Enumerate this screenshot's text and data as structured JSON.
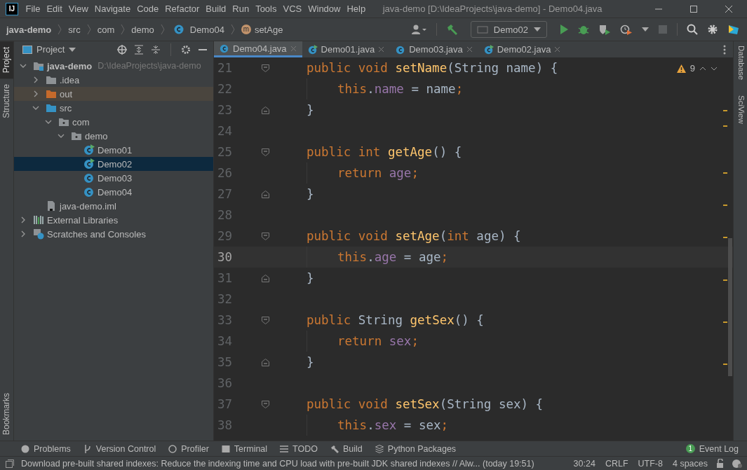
{
  "window": {
    "logo": "IJ",
    "title": "java-demo [D:\\IdeaProjects\\java-demo] - Demo04.java"
  },
  "menu": [
    "File",
    "Edit",
    "View",
    "Navigate",
    "Code",
    "Refactor",
    "Build",
    "Run",
    "Tools",
    "VCS",
    "Window",
    "Help"
  ],
  "breadcrumbs": [
    {
      "text": "java-demo",
      "kind": "path"
    },
    {
      "text": "src",
      "kind": "path"
    },
    {
      "text": "com",
      "kind": "path"
    },
    {
      "text": "demo",
      "kind": "path"
    },
    {
      "text": "Demo04",
      "kind": "class"
    },
    {
      "text": "setAge",
      "kind": "method",
      "icon_text": "m"
    }
  ],
  "run_config": "Demo02",
  "left_stripe": [
    {
      "label": "Project",
      "selected": true
    },
    {
      "label": "Structure",
      "selected": false
    }
  ],
  "left_stripe_bottom": "Bookmarks",
  "right_stripe": [
    "Database",
    "SciView"
  ],
  "project_panel": {
    "title": "Project",
    "tree": [
      {
        "label": "java-demo",
        "note": "D:\\IdeaProjects\\java-demo",
        "kind": "module",
        "expanded": true,
        "selected": false,
        "children": [
          {
            "label": ".idea",
            "kind": "folder",
            "expanded": false,
            "selected": false
          },
          {
            "label": "out",
            "kind": "excluded",
            "expanded": false,
            "selected": false
          },
          {
            "label": "src",
            "kind": "sources",
            "expanded": true,
            "selected": false,
            "children": [
              {
                "label": "com",
                "kind": "package",
                "expanded": true,
                "selected": false,
                "children": [
                  {
                    "label": "demo",
                    "kind": "package",
                    "expanded": true,
                    "selected": false,
                    "children": [
                      {
                        "label": "Demo01",
                        "kind": "runnable",
                        "selected": false
                      },
                      {
                        "label": "Demo02",
                        "kind": "runnable",
                        "selected": true
                      },
                      {
                        "label": "Demo03",
                        "kind": "class",
                        "selected": false
                      },
                      {
                        "label": "Demo04",
                        "kind": "class",
                        "selected": false
                      }
                    ]
                  }
                ]
              }
            ]
          },
          {
            "label": "java-demo.iml",
            "kind": "file",
            "selected": false
          }
        ]
      },
      {
        "label": "External Libraries",
        "kind": "libraries",
        "expanded": false,
        "selected": false
      },
      {
        "label": "Scratches and Consoles",
        "kind": "scratches",
        "expanded": false,
        "selected": false
      }
    ]
  },
  "tabs": [
    {
      "label": "Demo04.java",
      "kind": "class",
      "selected": true
    },
    {
      "label": "Demo01.java",
      "kind": "runnable",
      "selected": false
    },
    {
      "label": "Demo03.java",
      "kind": "class",
      "selected": false
    },
    {
      "label": "Demo02.java",
      "kind": "runnable",
      "selected": false
    }
  ],
  "inspection": {
    "warnings": "9"
  },
  "editor": {
    "lines": [
      {
        "number": "21",
        "kind": "open",
        "current": false,
        "tokens": [
          {
            "kind": "keyword",
            "text": "public void "
          },
          {
            "kind": "method",
            "text": "setName"
          },
          {
            "kind": "plain",
            "text": "(String name) {"
          }
        ]
      },
      {
        "number": "22",
        "kind": "body",
        "current": false,
        "tokens": [
          {
            "kind": "keyword",
            "text": "this"
          },
          {
            "kind": "plain",
            "text": "."
          },
          {
            "kind": "field",
            "text": "name"
          },
          {
            "kind": "plain",
            "text": " = name"
          },
          {
            "kind": "keyword",
            "text": ";"
          }
        ]
      },
      {
        "number": "23",
        "kind": "close",
        "current": false,
        "tokens": [
          {
            "kind": "plain",
            "text": "}"
          }
        ]
      },
      {
        "number": "24",
        "kind": "blank",
        "current": false
      },
      {
        "number": "25",
        "kind": "open",
        "current": false,
        "tokens": [
          {
            "kind": "keyword",
            "text": "public int "
          },
          {
            "kind": "method",
            "text": "getAge"
          },
          {
            "kind": "plain",
            "text": "() {"
          }
        ]
      },
      {
        "number": "26",
        "kind": "body",
        "current": false,
        "tokens": [
          {
            "kind": "keyword",
            "text": "return "
          },
          {
            "kind": "field",
            "text": "age"
          },
          {
            "kind": "keyword",
            "text": ";"
          }
        ]
      },
      {
        "number": "27",
        "kind": "close",
        "current": false,
        "tokens": [
          {
            "kind": "plain",
            "text": "}"
          }
        ]
      },
      {
        "number": "28",
        "kind": "blank",
        "current": false
      },
      {
        "number": "29",
        "kind": "open",
        "current": false,
        "tokens": [
          {
            "kind": "keyword",
            "text": "public void "
          },
          {
            "kind": "method",
            "text": "setAge"
          },
          {
            "kind": "plain",
            "text": "("
          },
          {
            "kind": "keyword",
            "text": "int "
          },
          {
            "kind": "plain",
            "text": "age) {"
          }
        ]
      },
      {
        "number": "30",
        "kind": "body",
        "current": true,
        "tokens": [
          {
            "kind": "keyword",
            "text": "this"
          },
          {
            "kind": "plain",
            "text": "."
          },
          {
            "kind": "field",
            "text": "age"
          },
          {
            "kind": "plain",
            "text": " = age"
          },
          {
            "kind": "keyword",
            "text": ";"
          }
        ]
      },
      {
        "number": "31",
        "kind": "close",
        "current": false,
        "tokens": [
          {
            "kind": "plain",
            "text": "}"
          }
        ]
      },
      {
        "number": "32",
        "kind": "blank",
        "current": false
      },
      {
        "number": "33",
        "kind": "open",
        "current": false,
        "tokens": [
          {
            "kind": "keyword",
            "text": "public "
          },
          {
            "kind": "plain",
            "text": "String "
          },
          {
            "kind": "method",
            "text": "getSex"
          },
          {
            "kind": "plain",
            "text": "() {"
          }
        ]
      },
      {
        "number": "34",
        "kind": "body",
        "current": false,
        "tokens": [
          {
            "kind": "keyword",
            "text": "return "
          },
          {
            "kind": "field",
            "text": "sex"
          },
          {
            "kind": "keyword",
            "text": ";"
          }
        ]
      },
      {
        "number": "35",
        "kind": "close",
        "current": false,
        "tokens": [
          {
            "kind": "plain",
            "text": "}"
          }
        ]
      },
      {
        "number": "36",
        "kind": "blank",
        "current": false
      },
      {
        "number": "37",
        "kind": "open",
        "current": false,
        "tokens": [
          {
            "kind": "keyword",
            "text": "public void "
          },
          {
            "kind": "method",
            "text": "setSex"
          },
          {
            "kind": "plain",
            "text": "(String sex) {"
          }
        ]
      },
      {
        "number": "38",
        "kind": "body",
        "current": false,
        "tokens": [
          {
            "kind": "keyword",
            "text": "this"
          },
          {
            "kind": "plain",
            "text": "."
          },
          {
            "kind": "field",
            "text": "sex"
          },
          {
            "kind": "plain",
            "text": " = sex"
          },
          {
            "kind": "keyword",
            "text": ";"
          }
        ]
      }
    ]
  },
  "tool_windows": [
    {
      "label": "Problems",
      "kind": "problems"
    },
    {
      "label": "Version Control",
      "kind": "vcs"
    },
    {
      "label": "Profiler",
      "kind": "profiler"
    },
    {
      "label": "Terminal",
      "kind": "terminal"
    },
    {
      "label": "TODO",
      "kind": "todo"
    },
    {
      "label": "Build",
      "kind": "build"
    },
    {
      "label": "Python Packages",
      "kind": "packages"
    }
  ],
  "event_log": {
    "label": "Event Log",
    "badge": "1"
  },
  "status_bar": {
    "message": "Download pre-built shared indexes: Reduce the indexing time and CPU load with pre-built JDK shared indexes // Alw... (today 19:51)",
    "position": "30:24",
    "line_separator": "CRLF",
    "encoding": "UTF-8",
    "indent": "4 spaces"
  }
}
